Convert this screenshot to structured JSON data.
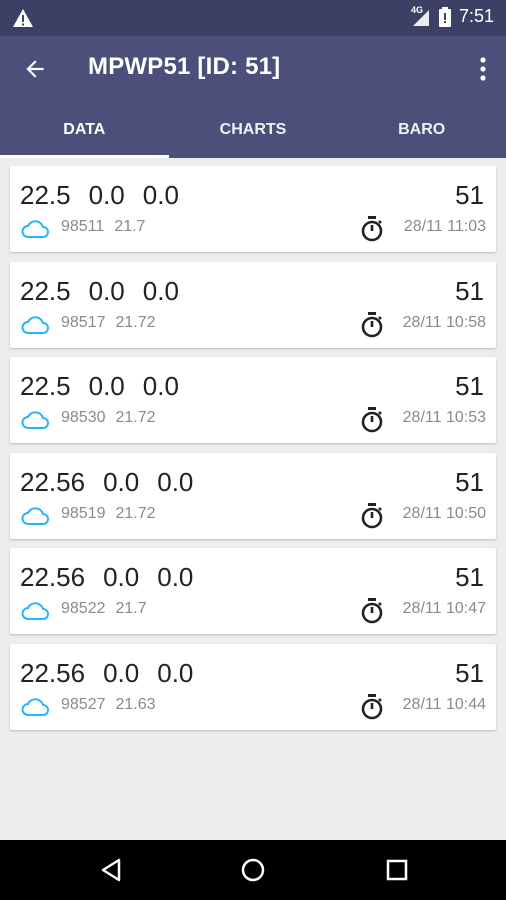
{
  "status_bar": {
    "warning_icon": "warning-icon",
    "signal": "4G",
    "time": "7:51"
  },
  "app_bar": {
    "title": "MPWP51 [ID: 51]",
    "back_icon": "arrow-back-icon",
    "menu_icon": "more-vert-icon"
  },
  "tabs": [
    {
      "label": "DATA",
      "active": true
    },
    {
      "label": "CHARTS",
      "active": false
    },
    {
      "label": "BARO",
      "active": false
    }
  ],
  "accent": "#4b4f79",
  "items": [
    {
      "v1": "22.5",
      "v2": "0.0",
      "v3": "0.0",
      "id": "51",
      "pressure": "98511",
      "temp": "21.7",
      "time": "28/11 11:03"
    },
    {
      "v1": "22.5",
      "v2": "0.0",
      "v3": "0.0",
      "id": "51",
      "pressure": "98517",
      "temp": "21.72",
      "time": "28/11 10:58"
    },
    {
      "v1": "22.5",
      "v2": "0.0",
      "v3": "0.0",
      "id": "51",
      "pressure": "98530",
      "temp": "21.72",
      "time": "28/11 10:53"
    },
    {
      "v1": "22.56",
      "v2": "0.0",
      "v3": "0.0",
      "id": "51",
      "pressure": "98519",
      "temp": "21.72",
      "time": "28/11 10:50"
    },
    {
      "v1": "22.56",
      "v2": "0.0",
      "v3": "0.0",
      "id": "51",
      "pressure": "98522",
      "temp": "21.7",
      "time": "28/11 10:47"
    },
    {
      "v1": "22.56",
      "v2": "0.0",
      "v3": "0.0",
      "id": "51",
      "pressure": "98527",
      "temp": "21.63",
      "time": "28/11 10:44"
    }
  ],
  "nav_bar": {
    "back": "nav-back-icon",
    "home": "nav-home-icon",
    "recents": "nav-recents-icon"
  }
}
